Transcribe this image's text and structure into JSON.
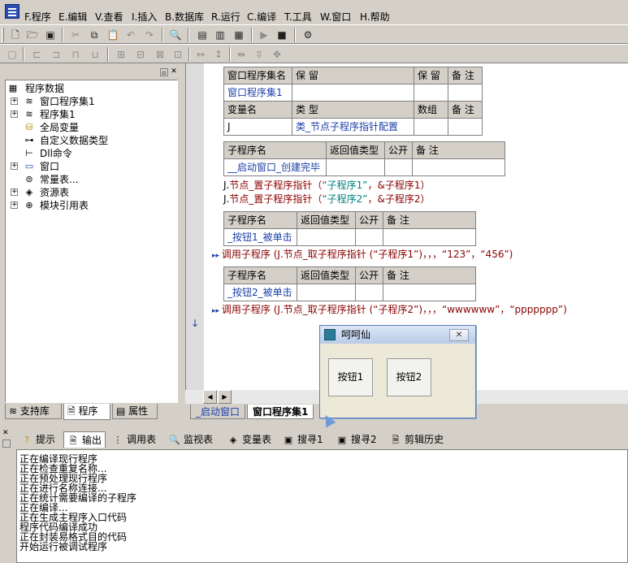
{
  "menu": [
    "F.程序",
    "E.编辑",
    "V.查看",
    "I.插入",
    "B.数据库",
    "R.运行",
    "C.编译",
    "T.工具",
    "W.窗口",
    "H.帮助"
  ],
  "toolbar1": {
    "new_icon": "new-file-icon",
    "open_icon": "open-folder-icon",
    "save_icon": "save-icon",
    "cut_icon": "cut-icon",
    "copy_icon": "copy-icon",
    "paste_icon": "paste-icon",
    "undo_icon": "undo-icon",
    "redo_icon": "redo-icon",
    "find_icon": "find-icon",
    "run_icon": "run-icon",
    "stop_icon": "stop-icon",
    "debug_icon": "debug-icon"
  },
  "tree": {
    "root": "程序数据",
    "items": [
      "窗口程序集1",
      "程序集1",
      "全局变量",
      "自定义数据类型",
      "Dll命令",
      "窗口",
      "常量表...",
      "资源表",
      "模块引用表"
    ]
  },
  "left_tabs": [
    "支持库",
    "程序",
    "属性"
  ],
  "editor": {
    "assembly_table": {
      "header": [
        "窗口程序集名",
        "保 留",
        "保 留",
        "备 注"
      ],
      "row": [
        "窗口程序集1",
        "",
        "",
        ""
      ],
      "var_header": [
        "变量名",
        "类 型",
        "数组",
        "备 注"
      ],
      "var_row": [
        "J",
        "类_节点子程序指针配置",
        "",
        ""
      ]
    },
    "sub1": {
      "header": [
        "子程序名",
        "返回值类型",
        "公开",
        "备 注"
      ],
      "row": [
        "__启动窗口_创建完毕",
        "",
        "",
        ""
      ],
      "lines": [
        {
          "obj": "J.",
          "fn": "节点_置子程序指针",
          "open": "（",
          "str": "“子程序1”",
          "rest": "，&子程序1）"
        },
        {
          "obj": "J.",
          "fn": "节点_置子程序指针",
          "open": "（",
          "str": "“子程序2”",
          "rest": "，&子程序2）"
        }
      ]
    },
    "sub2": {
      "header": [
        "子程序名",
        "返回值类型",
        "公开",
        "备 注"
      ],
      "row": [
        "_按钮1_被单击",
        "",
        "",
        ""
      ],
      "line": "调用子程序 (J.节点_取子程序指针 (“子程序1”)，，，“123”，“456”)"
    },
    "sub3": {
      "header": [
        "子程序名",
        "返回值类型",
        "公开",
        "备 注"
      ],
      "row": [
        "_按钮2_被单击",
        "",
        "",
        ""
      ],
      "line": "调用子程序 (J.节点_取子程序指针 (“子程序2”)，，，“wwwwww”，“ppppppp”)"
    }
  },
  "editor_tabs": [
    "_启动窗口",
    "窗口程序集1"
  ],
  "bottom_tabs": [
    "提示",
    "输出",
    "调用表",
    "监视表",
    "变量表",
    "搜寻1",
    "搜寻2",
    "剪辑历史"
  ],
  "output_lines": [
    "正在编译现行程序",
    "正在检查重复名称...",
    "正在预处理现行程序",
    "正在进行名称连接...",
    "正在统计需要编译的子程序",
    "正在编译...",
    "正在生成主程序入口代码",
    "程序代码编译成功",
    "正在封装易格式目的代码",
    "开始运行被调试程序"
  ],
  "dialog": {
    "title": "呵呵仙",
    "button1": "按钮1",
    "button2": "按钮2"
  }
}
